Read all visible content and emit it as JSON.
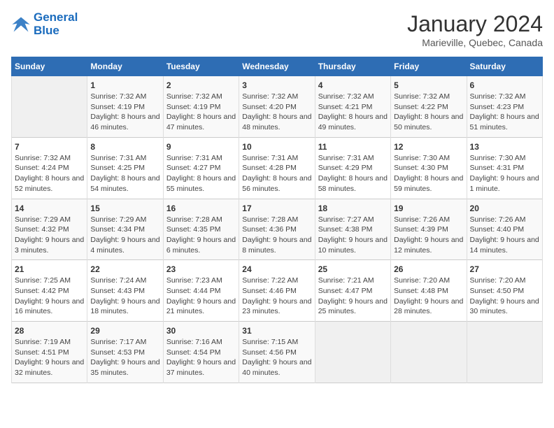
{
  "header": {
    "logo_line1": "General",
    "logo_line2": "Blue",
    "month": "January 2024",
    "location": "Marieville, Quebec, Canada"
  },
  "weekdays": [
    "Sunday",
    "Monday",
    "Tuesday",
    "Wednesday",
    "Thursday",
    "Friday",
    "Saturday"
  ],
  "weeks": [
    [
      {
        "day": "",
        "sunrise": "",
        "sunset": "",
        "daylight": "",
        "empty": true
      },
      {
        "day": "1",
        "sunrise": "Sunrise: 7:32 AM",
        "sunset": "Sunset: 4:19 PM",
        "daylight": "Daylight: 8 hours and 46 minutes."
      },
      {
        "day": "2",
        "sunrise": "Sunrise: 7:32 AM",
        "sunset": "Sunset: 4:19 PM",
        "daylight": "Daylight: 8 hours and 47 minutes."
      },
      {
        "day": "3",
        "sunrise": "Sunrise: 7:32 AM",
        "sunset": "Sunset: 4:20 PM",
        "daylight": "Daylight: 8 hours and 48 minutes."
      },
      {
        "day": "4",
        "sunrise": "Sunrise: 7:32 AM",
        "sunset": "Sunset: 4:21 PM",
        "daylight": "Daylight: 8 hours and 49 minutes."
      },
      {
        "day": "5",
        "sunrise": "Sunrise: 7:32 AM",
        "sunset": "Sunset: 4:22 PM",
        "daylight": "Daylight: 8 hours and 50 minutes."
      },
      {
        "day": "6",
        "sunrise": "Sunrise: 7:32 AM",
        "sunset": "Sunset: 4:23 PM",
        "daylight": "Daylight: 8 hours and 51 minutes."
      }
    ],
    [
      {
        "day": "7",
        "sunrise": "Sunrise: 7:32 AM",
        "sunset": "Sunset: 4:24 PM",
        "daylight": "Daylight: 8 hours and 52 minutes."
      },
      {
        "day": "8",
        "sunrise": "Sunrise: 7:31 AM",
        "sunset": "Sunset: 4:25 PM",
        "daylight": "Daylight: 8 hours and 54 minutes."
      },
      {
        "day": "9",
        "sunrise": "Sunrise: 7:31 AM",
        "sunset": "Sunset: 4:27 PM",
        "daylight": "Daylight: 8 hours and 55 minutes."
      },
      {
        "day": "10",
        "sunrise": "Sunrise: 7:31 AM",
        "sunset": "Sunset: 4:28 PM",
        "daylight": "Daylight: 8 hours and 56 minutes."
      },
      {
        "day": "11",
        "sunrise": "Sunrise: 7:31 AM",
        "sunset": "Sunset: 4:29 PM",
        "daylight": "Daylight: 8 hours and 58 minutes."
      },
      {
        "day": "12",
        "sunrise": "Sunrise: 7:30 AM",
        "sunset": "Sunset: 4:30 PM",
        "daylight": "Daylight: 8 hours and 59 minutes."
      },
      {
        "day": "13",
        "sunrise": "Sunrise: 7:30 AM",
        "sunset": "Sunset: 4:31 PM",
        "daylight": "Daylight: 9 hours and 1 minute."
      }
    ],
    [
      {
        "day": "14",
        "sunrise": "Sunrise: 7:29 AM",
        "sunset": "Sunset: 4:32 PM",
        "daylight": "Daylight: 9 hours and 3 minutes."
      },
      {
        "day": "15",
        "sunrise": "Sunrise: 7:29 AM",
        "sunset": "Sunset: 4:34 PM",
        "daylight": "Daylight: 9 hours and 4 minutes."
      },
      {
        "day": "16",
        "sunrise": "Sunrise: 7:28 AM",
        "sunset": "Sunset: 4:35 PM",
        "daylight": "Daylight: 9 hours and 6 minutes."
      },
      {
        "day": "17",
        "sunrise": "Sunrise: 7:28 AM",
        "sunset": "Sunset: 4:36 PM",
        "daylight": "Daylight: 9 hours and 8 minutes."
      },
      {
        "day": "18",
        "sunrise": "Sunrise: 7:27 AM",
        "sunset": "Sunset: 4:38 PM",
        "daylight": "Daylight: 9 hours and 10 minutes."
      },
      {
        "day": "19",
        "sunrise": "Sunrise: 7:26 AM",
        "sunset": "Sunset: 4:39 PM",
        "daylight": "Daylight: 9 hours and 12 minutes."
      },
      {
        "day": "20",
        "sunrise": "Sunrise: 7:26 AM",
        "sunset": "Sunset: 4:40 PM",
        "daylight": "Daylight: 9 hours and 14 minutes."
      }
    ],
    [
      {
        "day": "21",
        "sunrise": "Sunrise: 7:25 AM",
        "sunset": "Sunset: 4:42 PM",
        "daylight": "Daylight: 9 hours and 16 minutes."
      },
      {
        "day": "22",
        "sunrise": "Sunrise: 7:24 AM",
        "sunset": "Sunset: 4:43 PM",
        "daylight": "Daylight: 9 hours and 18 minutes."
      },
      {
        "day": "23",
        "sunrise": "Sunrise: 7:23 AM",
        "sunset": "Sunset: 4:44 PM",
        "daylight": "Daylight: 9 hours and 21 minutes."
      },
      {
        "day": "24",
        "sunrise": "Sunrise: 7:22 AM",
        "sunset": "Sunset: 4:46 PM",
        "daylight": "Daylight: 9 hours and 23 minutes."
      },
      {
        "day": "25",
        "sunrise": "Sunrise: 7:21 AM",
        "sunset": "Sunset: 4:47 PM",
        "daylight": "Daylight: 9 hours and 25 minutes."
      },
      {
        "day": "26",
        "sunrise": "Sunrise: 7:20 AM",
        "sunset": "Sunset: 4:48 PM",
        "daylight": "Daylight: 9 hours and 28 minutes."
      },
      {
        "day": "27",
        "sunrise": "Sunrise: 7:20 AM",
        "sunset": "Sunset: 4:50 PM",
        "daylight": "Daylight: 9 hours and 30 minutes."
      }
    ],
    [
      {
        "day": "28",
        "sunrise": "Sunrise: 7:19 AM",
        "sunset": "Sunset: 4:51 PM",
        "daylight": "Daylight: 9 hours and 32 minutes."
      },
      {
        "day": "29",
        "sunrise": "Sunrise: 7:17 AM",
        "sunset": "Sunset: 4:53 PM",
        "daylight": "Daylight: 9 hours and 35 minutes."
      },
      {
        "day": "30",
        "sunrise": "Sunrise: 7:16 AM",
        "sunset": "Sunset: 4:54 PM",
        "daylight": "Daylight: 9 hours and 37 minutes."
      },
      {
        "day": "31",
        "sunrise": "Sunrise: 7:15 AM",
        "sunset": "Sunset: 4:56 PM",
        "daylight": "Daylight: 9 hours and 40 minutes."
      },
      {
        "day": "",
        "sunrise": "",
        "sunset": "",
        "daylight": "",
        "empty": true
      },
      {
        "day": "",
        "sunrise": "",
        "sunset": "",
        "daylight": "",
        "empty": true
      },
      {
        "day": "",
        "sunrise": "",
        "sunset": "",
        "daylight": "",
        "empty": true
      }
    ]
  ]
}
